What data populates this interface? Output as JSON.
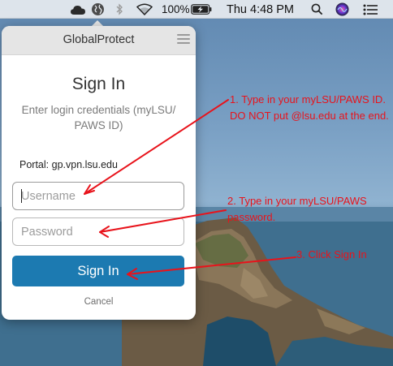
{
  "menubar": {
    "battery_percent": "100%",
    "clock": "Thu 4:48 PM",
    "icons": [
      "cloud-icon",
      "globe-icon",
      "bluetooth-icon",
      "wifi-icon",
      "battery-charging-icon",
      "spotlight-search-icon",
      "siri-icon",
      "notification-center-icon"
    ]
  },
  "popover": {
    "app_title": "GlobalProtect",
    "heading": "Sign In",
    "instructions": "Enter login credentials (myLSU/ PAWS ID)",
    "portal_label": "Portal:",
    "portal_value": "gp.vpn.lsu.edu",
    "username_placeholder": "Username",
    "username_value": "",
    "password_placeholder": "Password",
    "password_value": "",
    "signin_label": "Sign In",
    "cancel_label": "Cancel",
    "accent_color": "#1c7ab1"
  },
  "annotations": {
    "color": "#e8131b",
    "step1": "1. Type in your myLSU/PAWS ID. DO NOT put @lsu.edu at the end.",
    "step2": "2. Type in your myLSU/PAWS password.",
    "step3": "3. Click Sign In"
  }
}
